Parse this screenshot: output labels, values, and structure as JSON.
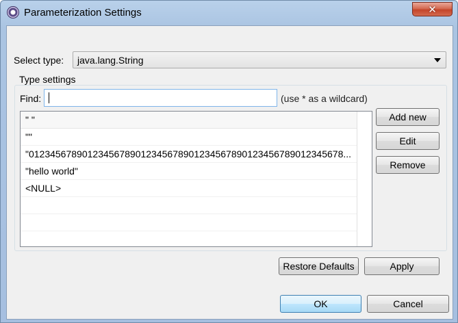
{
  "window": {
    "title": "Parameterization Settings",
    "close_symbol": "✕",
    "icon": "eclipse-app-icon"
  },
  "select_type": {
    "label": "Select type:",
    "value": "java.lang.String"
  },
  "type_settings": {
    "title": "Type settings",
    "find_label": "Find:",
    "find_value": "",
    "wildcard_hint": "(use * as a wildcard)",
    "items": [
      "\" \"",
      "\"\"",
      "\"01234567890123456789012345678901234567890123456789012345678...",
      "\"hello world\"",
      "<NULL>"
    ],
    "buttons": {
      "add_new": "Add new",
      "edit": "Edit",
      "remove": "Remove"
    }
  },
  "actions": {
    "restore_defaults": "Restore Defaults",
    "apply": "Apply",
    "ok": "OK",
    "cancel": "Cancel"
  }
}
